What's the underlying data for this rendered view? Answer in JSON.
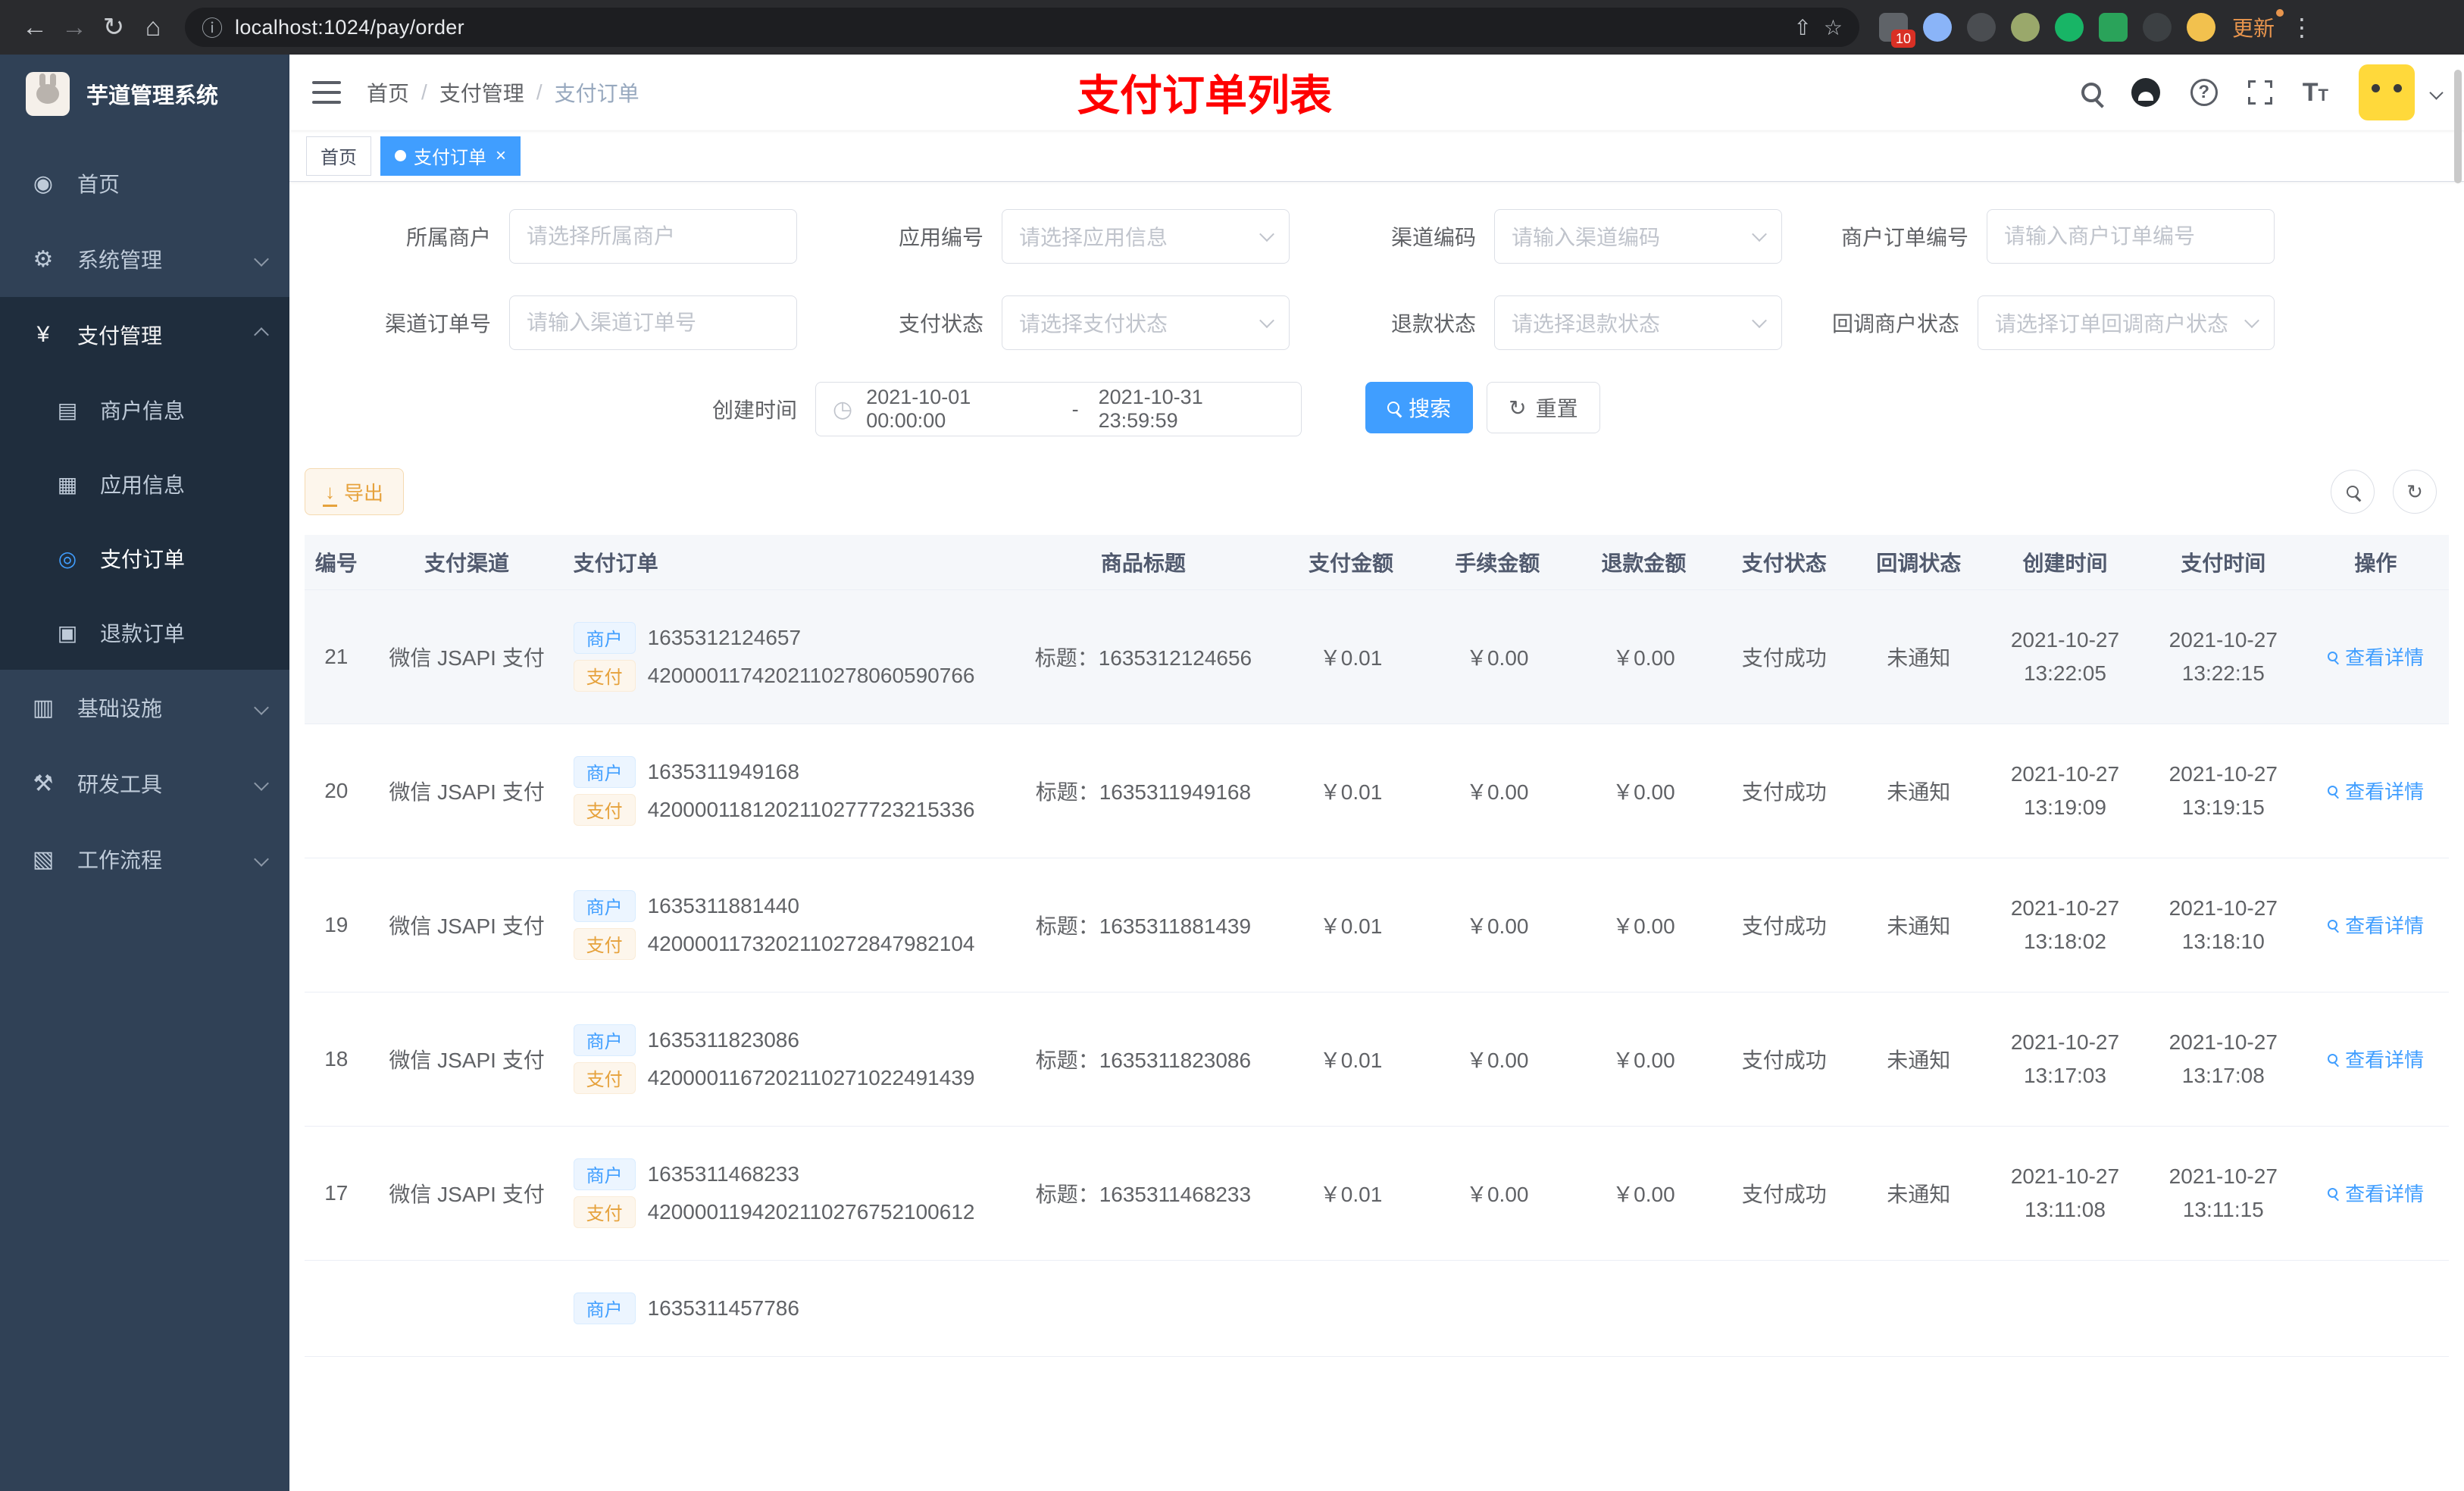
{
  "browser": {
    "url": "localhost:1024/pay/order",
    "update_label": "更新",
    "extension_badge": "10"
  },
  "sidebar": {
    "logo_title": "芋道管理系统",
    "items": [
      {
        "label": "首页"
      },
      {
        "label": "系统管理"
      },
      {
        "label": "支付管理",
        "children": [
          {
            "label": "商户信息"
          },
          {
            "label": "应用信息"
          },
          {
            "label": "支付订单"
          },
          {
            "label": "退款订单"
          }
        ]
      },
      {
        "label": "基础设施"
      },
      {
        "label": "研发工具"
      },
      {
        "label": "工作流程"
      }
    ]
  },
  "navbar": {
    "breadcrumb": [
      "首页",
      "支付管理",
      "支付订单"
    ],
    "annotation": "支付订单列表"
  },
  "tabs": [
    {
      "label": "首页"
    },
    {
      "label": "支付订单"
    }
  ],
  "filters": {
    "fields": [
      {
        "label": "所属商户",
        "placeholder": "请选择所属商户"
      },
      {
        "label": "应用编号",
        "placeholder": "请选择应用信息"
      },
      {
        "label": "渠道编码",
        "placeholder": "请输入渠道编码"
      },
      {
        "label": "商户订单编号",
        "placeholder": "请输入商户订单编号"
      },
      {
        "label": "渠道订单号",
        "placeholder": "请输入渠道订单号"
      },
      {
        "label": "支付状态",
        "placeholder": "请选择支付状态"
      },
      {
        "label": "退款状态",
        "placeholder": "请选择退款状态"
      },
      {
        "label": "回调商户状态",
        "placeholder": "请选择订单回调商户状态"
      }
    ],
    "date_label": "创建时间",
    "date_start": "2021-10-01 00:00:00",
    "date_separator": "-",
    "date_end": "2021-10-31 23:59:59",
    "search_label": "搜索",
    "reset_label": "重置"
  },
  "toolbar": {
    "export_label": "导出"
  },
  "table": {
    "columns": [
      "编号",
      "支付渠道",
      "支付订单",
      "商品标题",
      "支付金额",
      "手续金额",
      "退款金额",
      "支付状态",
      "回调状态",
      "创建时间",
      "支付时间",
      "操作"
    ],
    "tag_merchant": "商户",
    "tag_pay": "支付",
    "action_label": "查看详情",
    "rows": [
      {
        "id": "21",
        "channel": "微信 JSAPI 支付",
        "merchant_no": "1635312124657",
        "pay_no": "4200001174202110278060590766",
        "title": "标题：1635312124656",
        "amount": "￥0.01",
        "fee": "￥0.00",
        "refund": "￥0.00",
        "status": "支付成功",
        "notify": "未通知",
        "created_date": "2021-10-27",
        "created_time": "13:22:05",
        "paid_date": "2021-10-27",
        "paid_time": "13:22:15"
      },
      {
        "id": "20",
        "channel": "微信 JSAPI 支付",
        "merchant_no": "1635311949168",
        "pay_no": "4200001181202110277723215336",
        "title": "标题：1635311949168",
        "amount": "￥0.01",
        "fee": "￥0.00",
        "refund": "￥0.00",
        "status": "支付成功",
        "notify": "未通知",
        "created_date": "2021-10-27",
        "created_time": "13:19:09",
        "paid_date": "2021-10-27",
        "paid_time": "13:19:15"
      },
      {
        "id": "19",
        "channel": "微信 JSAPI 支付",
        "merchant_no": "1635311881440",
        "pay_no": "4200001173202110272847982104",
        "title": "标题：1635311881439",
        "amount": "￥0.01",
        "fee": "￥0.00",
        "refund": "￥0.00",
        "status": "支付成功",
        "notify": "未通知",
        "created_date": "2021-10-27",
        "created_time": "13:18:02",
        "paid_date": "2021-10-27",
        "paid_time": "13:18:10"
      },
      {
        "id": "18",
        "channel": "微信 JSAPI 支付",
        "merchant_no": "1635311823086",
        "pay_no": "4200001167202110271022491439",
        "title": "标题：1635311823086",
        "amount": "￥0.01",
        "fee": "￥0.00",
        "refund": "￥0.00",
        "status": "支付成功",
        "notify": "未通知",
        "created_date": "2021-10-27",
        "created_time": "13:17:03",
        "paid_date": "2021-10-27",
        "paid_time": "13:17:08"
      },
      {
        "id": "17",
        "channel": "微信 JSAPI 支付",
        "merchant_no": "1635311468233",
        "pay_no": "4200001194202110276752100612",
        "title": "标题：1635311468233",
        "amount": "￥0.01",
        "fee": "￥0.00",
        "refund": "￥0.00",
        "status": "支付成功",
        "notify": "未通知",
        "created_date": "2021-10-27",
        "created_time": "13:11:08",
        "paid_date": "2021-10-27",
        "paid_time": "13:11:15"
      }
    ],
    "partial_row": {
      "merchant_no": "1635311457786"
    }
  },
  "colors": {
    "accent": "#409eff",
    "annotation_red": "#ff0000",
    "warning": "#e6a23c"
  }
}
